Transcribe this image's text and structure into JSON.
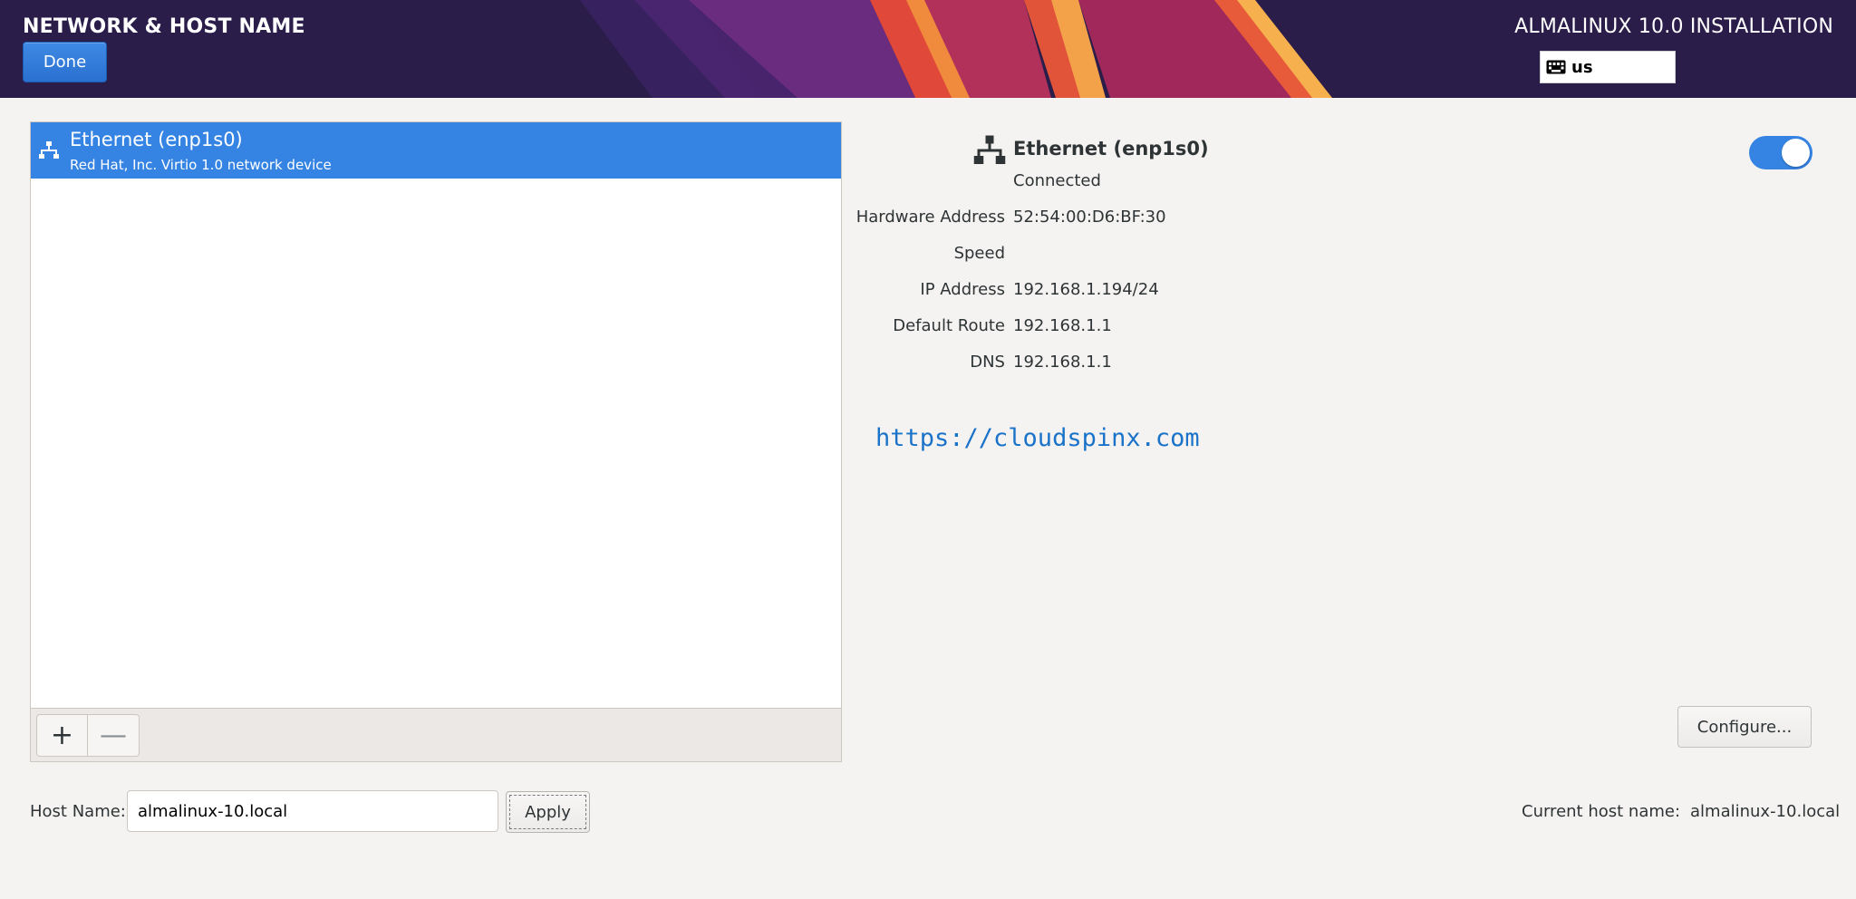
{
  "header": {
    "spoke_title": "NETWORK & HOST NAME",
    "done_label": "Done",
    "product_title": "ALMALINUX 10.0 INSTALLATION",
    "keyboard_layout": "us",
    "keyboard_icon": "keyboard-icon"
  },
  "devices": [
    {
      "name": "Ethernet (enp1s0)",
      "description": "Red Hat, Inc. Virtio 1.0 network device",
      "icon": "wired-network-icon",
      "selected": true
    }
  ],
  "toolbar": {
    "add_label": "+",
    "remove_label": "—"
  },
  "details": {
    "name": "Ethernet (enp1s0)",
    "status": "Connected",
    "enabled": true,
    "rows": [
      {
        "label": "Hardware Address",
        "value": "52:54:00:D6:BF:30"
      },
      {
        "label": "Speed",
        "value": ""
      },
      {
        "label": "IP Address",
        "value": "192.168.1.194/24"
      },
      {
        "label": "Default Route",
        "value": "192.168.1.1"
      },
      {
        "label": "DNS",
        "value": "192.168.1.1"
      }
    ],
    "configure_label": "Configure..."
  },
  "watermark": "https://cloudspinx.com",
  "hostname": {
    "label": "Host Name:",
    "value": "almalinux-10.local",
    "apply_label": "Apply",
    "current_label": "Current host name:",
    "current_value": "almalinux-10.local"
  },
  "colors": {
    "header_bg": "#2b1d4a",
    "accent": "#3584e4",
    "watermark": "#1a73c9"
  }
}
